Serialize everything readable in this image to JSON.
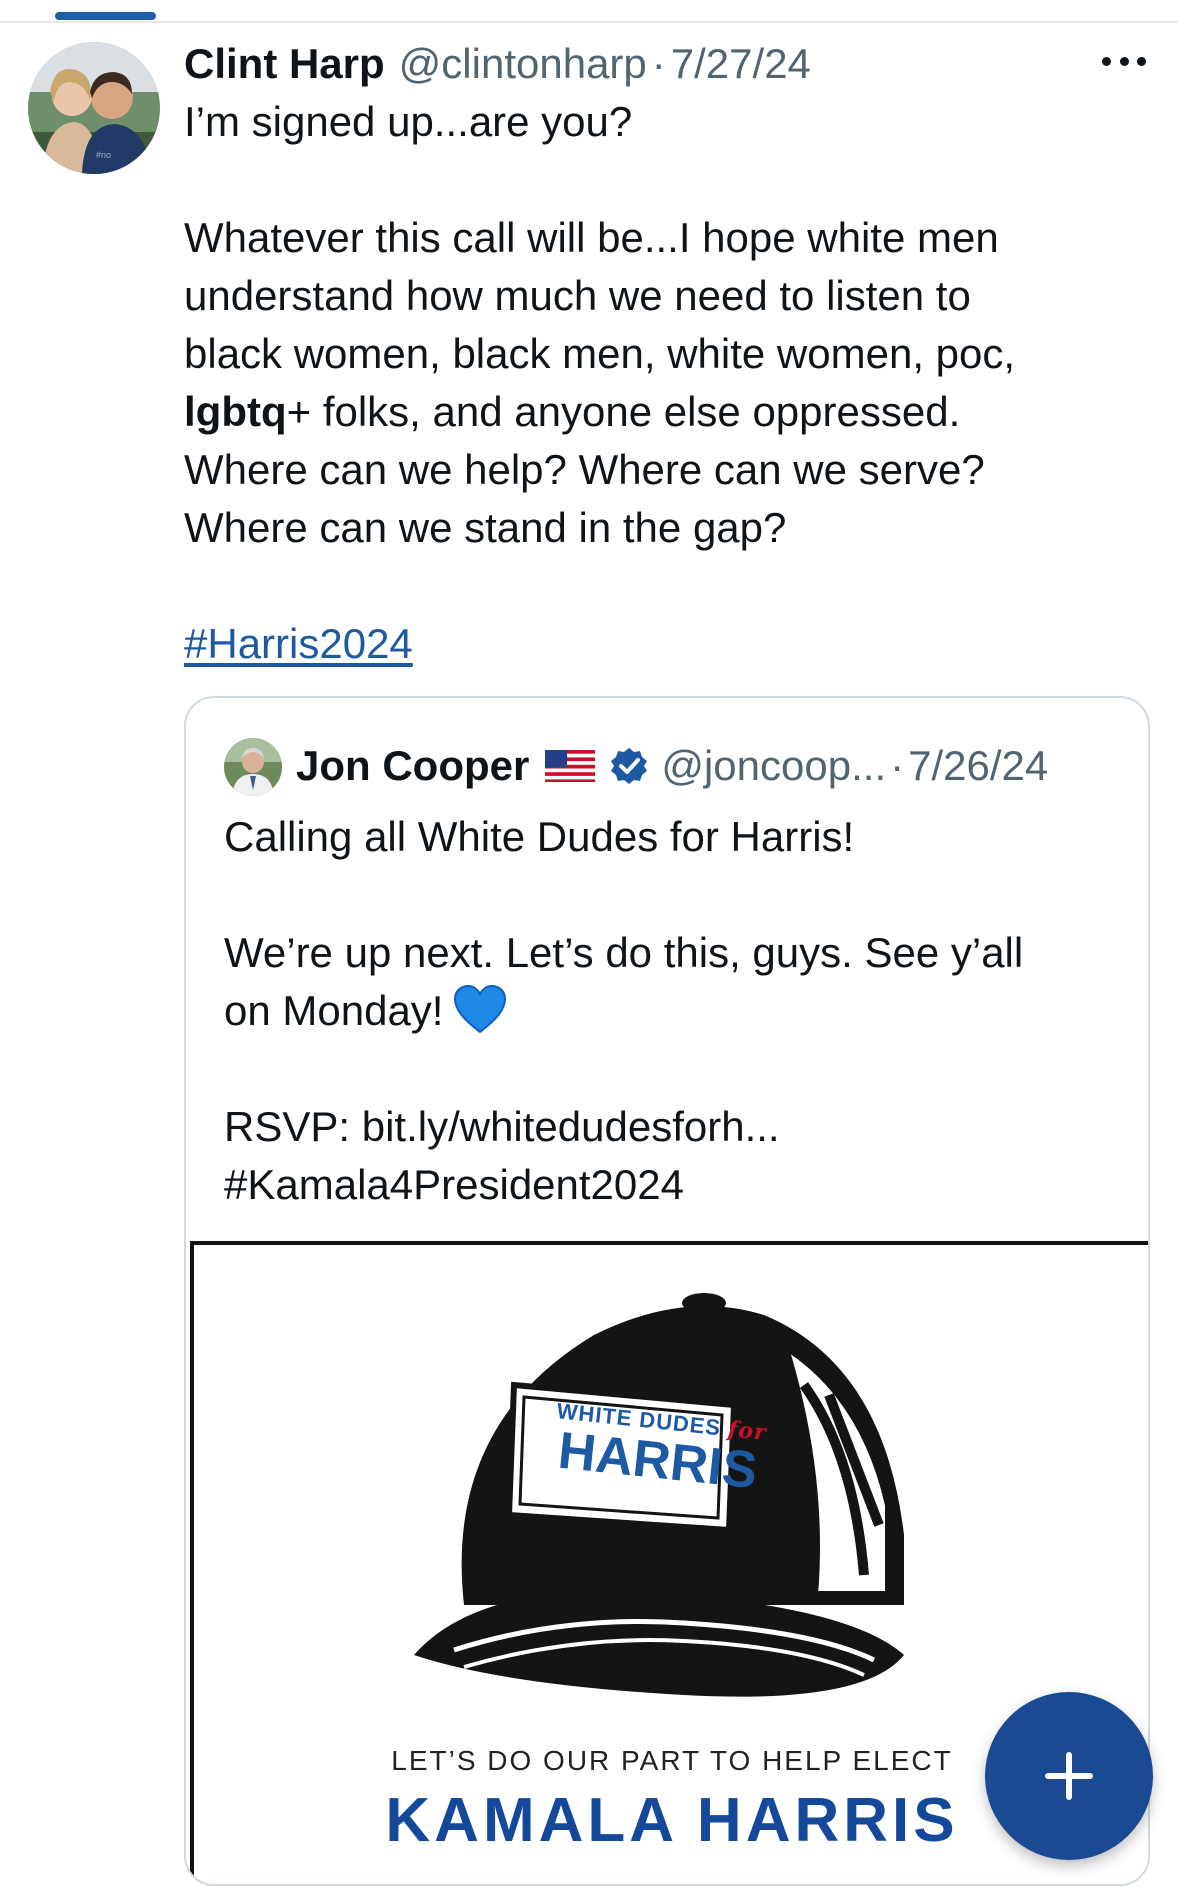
{
  "post": {
    "author_name": "Clint Harp",
    "handle": "@clintonharp",
    "separator": "·",
    "date": "7/27/24",
    "avatar_icon": "profile-photo-couple",
    "more_icon": "more-horizontal-icon",
    "line1": "I’m signed up...are you?",
    "paragraph": [
      "Whatever this call will be...I hope white men",
      "understand how much we need to listen to",
      "black women, black men, white women, poc,"
    ],
    "bold_word": "lgbtq",
    "line_after_bold": "+ folks, and anyone else oppressed.",
    "paragraph_end": [
      "Where can we help? Where can we serve?",
      "Where can we stand in the gap?"
    ],
    "hashtag": "#Harris2024"
  },
  "quote": {
    "author_name": "Jon Cooper",
    "flag_icon": "us-flag-icon",
    "verified_icon": "verified-badge-icon",
    "handle": "@joncoop...",
    "separator": "·",
    "date": "7/26/24",
    "line1": "Calling all White Dudes for Harris!",
    "line2": "We’re up next. Let’s do this, guys. See y’all",
    "line3": "on Monday!",
    "heart_icon": "blue-heart-emoji",
    "rsvp": "RSVP: bit.ly/whitedudesforh...",
    "hashtag": "#Kamala4President2024",
    "image": {
      "patch_line1": "WHITE DUDES",
      "patch_for": "for",
      "patch_line2": "HARRIS",
      "tagline": "LET’S DO OUR PART TO HELP ELECT",
      "name": "KAMALA HARRIS"
    }
  },
  "compose_button": {
    "icon": "plus-icon"
  },
  "colors": {
    "link": "#1d5aa3",
    "fab": "#1a4a93",
    "brand_blue": "#14489a",
    "muted": "#536471"
  }
}
